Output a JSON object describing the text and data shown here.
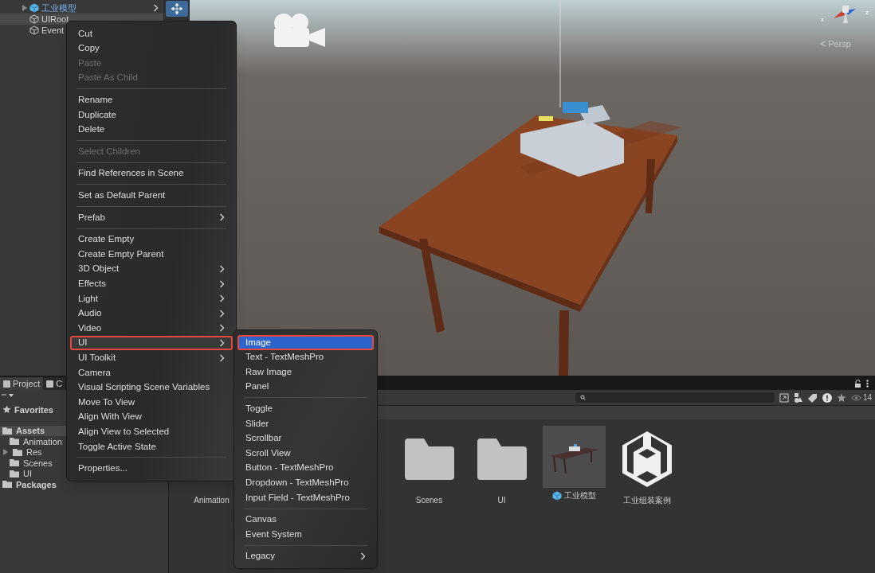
{
  "hierarchy": {
    "items": [
      {
        "label": "工业模型",
        "kind": "prefab",
        "selected": false,
        "expanded": false
      },
      {
        "label": "UIRoot",
        "kind": "object",
        "selected": true
      },
      {
        "label": "Event",
        "kind": "object",
        "selected": false
      }
    ]
  },
  "scene": {
    "view_label": "Persp",
    "axes": [
      "x",
      "z"
    ]
  },
  "context_menu": {
    "items": [
      {
        "kind": "item",
        "label": "Cut",
        "disabled": false,
        "submenu": false,
        "selected": false
      },
      {
        "kind": "item",
        "label": "Copy",
        "disabled": false,
        "submenu": false,
        "selected": false
      },
      {
        "kind": "item",
        "label": "Paste",
        "disabled": true,
        "submenu": false,
        "selected": false
      },
      {
        "kind": "item",
        "label": "Paste As Child",
        "disabled": true,
        "submenu": false,
        "selected": false
      },
      {
        "kind": "separator"
      },
      {
        "kind": "item",
        "label": "Rename",
        "disabled": false,
        "submenu": false,
        "selected": false
      },
      {
        "kind": "item",
        "label": "Duplicate",
        "disabled": false,
        "submenu": false,
        "selected": false
      },
      {
        "kind": "item",
        "label": "Delete",
        "disabled": false,
        "submenu": false,
        "selected": false
      },
      {
        "kind": "separator"
      },
      {
        "kind": "item",
        "label": "Select Children",
        "disabled": true,
        "submenu": false,
        "selected": false
      },
      {
        "kind": "separator"
      },
      {
        "kind": "item",
        "label": "Find References in Scene",
        "disabled": false,
        "submenu": false,
        "selected": false
      },
      {
        "kind": "separator"
      },
      {
        "kind": "item",
        "label": "Set as Default Parent",
        "disabled": false,
        "submenu": false,
        "selected": false
      },
      {
        "kind": "separator"
      },
      {
        "kind": "item",
        "label": "Prefab",
        "disabled": false,
        "submenu": true,
        "selected": false
      },
      {
        "kind": "separator"
      },
      {
        "kind": "item",
        "label": "Create Empty",
        "disabled": false,
        "submenu": false,
        "selected": false
      },
      {
        "kind": "item",
        "label": "Create Empty Parent",
        "disabled": false,
        "submenu": false,
        "selected": false
      },
      {
        "kind": "item",
        "label": "3D Object",
        "disabled": false,
        "submenu": true,
        "selected": false
      },
      {
        "kind": "item",
        "label": "Effects",
        "disabled": false,
        "submenu": true,
        "selected": false
      },
      {
        "kind": "item",
        "label": "Light",
        "disabled": false,
        "submenu": true,
        "selected": false
      },
      {
        "kind": "item",
        "label": "Audio",
        "disabled": false,
        "submenu": true,
        "selected": false
      },
      {
        "kind": "item",
        "label": "Video",
        "disabled": false,
        "submenu": true,
        "selected": false
      },
      {
        "kind": "item",
        "label": "UI",
        "disabled": false,
        "submenu": true,
        "selected": true
      },
      {
        "kind": "item",
        "label": "UI Toolkit",
        "disabled": false,
        "submenu": true,
        "selected": false
      },
      {
        "kind": "item",
        "label": "Camera",
        "disabled": false,
        "submenu": false,
        "selected": false
      },
      {
        "kind": "item",
        "label": "Visual Scripting Scene Variables",
        "disabled": false,
        "submenu": false,
        "selected": false
      },
      {
        "kind": "item",
        "label": "Move To View",
        "disabled": false,
        "submenu": false,
        "selected": false
      },
      {
        "kind": "item",
        "label": "Align With View",
        "disabled": false,
        "submenu": false,
        "selected": false
      },
      {
        "kind": "item",
        "label": "Align View to Selected",
        "disabled": false,
        "submenu": false,
        "selected": false
      },
      {
        "kind": "item",
        "label": "Toggle Active State",
        "disabled": false,
        "submenu": false,
        "selected": false
      },
      {
        "kind": "separator"
      },
      {
        "kind": "item",
        "label": "Properties...",
        "disabled": false,
        "submenu": false,
        "selected": false
      }
    ]
  },
  "ui_submenu": {
    "items": [
      {
        "kind": "item",
        "label": "Image",
        "submenu": false,
        "selected": true,
        "highlighted": true
      },
      {
        "kind": "item",
        "label": "Text - TextMeshPro",
        "submenu": false,
        "selected": false,
        "highlighted": false
      },
      {
        "kind": "item",
        "label": "Raw Image",
        "submenu": false,
        "selected": false,
        "highlighted": false
      },
      {
        "kind": "item",
        "label": "Panel",
        "submenu": false,
        "selected": false,
        "highlighted": false
      },
      {
        "kind": "separator"
      },
      {
        "kind": "item",
        "label": "Toggle",
        "submenu": false,
        "selected": false,
        "highlighted": false
      },
      {
        "kind": "item",
        "label": "Slider",
        "submenu": false,
        "selected": false,
        "highlighted": false
      },
      {
        "kind": "item",
        "label": "Scrollbar",
        "submenu": false,
        "selected": false,
        "highlighted": false
      },
      {
        "kind": "item",
        "label": "Scroll View",
        "submenu": false,
        "selected": false,
        "highlighted": false
      },
      {
        "kind": "item",
        "label": "Button - TextMeshPro",
        "submenu": false,
        "selected": false,
        "highlighted": false
      },
      {
        "kind": "item",
        "label": "Dropdown - TextMeshPro",
        "submenu": false,
        "selected": false,
        "highlighted": false
      },
      {
        "kind": "item",
        "label": "Input Field - TextMeshPro",
        "submenu": false,
        "selected": false,
        "highlighted": false
      },
      {
        "kind": "separator"
      },
      {
        "kind": "item",
        "label": "Canvas",
        "submenu": false,
        "selected": false,
        "highlighted": false
      },
      {
        "kind": "item",
        "label": "Event System",
        "submenu": false,
        "selected": false,
        "highlighted": false
      },
      {
        "kind": "separator"
      },
      {
        "kind": "item",
        "label": "Legacy",
        "submenu": true,
        "selected": false,
        "highlighted": false
      }
    ]
  },
  "project": {
    "tabs": [
      {
        "label": "Project",
        "selected": true
      },
      {
        "label": "C",
        "selected": false
      }
    ],
    "tree": [
      {
        "label": "Favorites",
        "kind": "favorites",
        "selected": false
      },
      {
        "label": "Assets",
        "kind": "folder",
        "selected": true,
        "expanded": true,
        "children": [
          {
            "label": "Animation",
            "kind": "folder",
            "selected": false
          },
          {
            "label": "Res",
            "kind": "folder",
            "selected": false,
            "expanded": false
          },
          {
            "label": "Scenes",
            "kind": "folder",
            "selected": false
          },
          {
            "label": "UI",
            "kind": "folder",
            "selected": false
          }
        ]
      },
      {
        "label": "Packages",
        "kind": "folder",
        "selected": false
      }
    ],
    "visible_count": "14",
    "assets": [
      {
        "label": "Animation",
        "kind": "label_only"
      },
      {
        "kind": "empty"
      },
      {
        "kind": "empty"
      },
      {
        "label": "Scenes",
        "kind": "folder"
      },
      {
        "label": "UI",
        "kind": "folder"
      },
      {
        "label": "工业模型",
        "kind": "prefab"
      },
      {
        "label": "工业组装案例",
        "kind": "scene"
      }
    ]
  }
}
